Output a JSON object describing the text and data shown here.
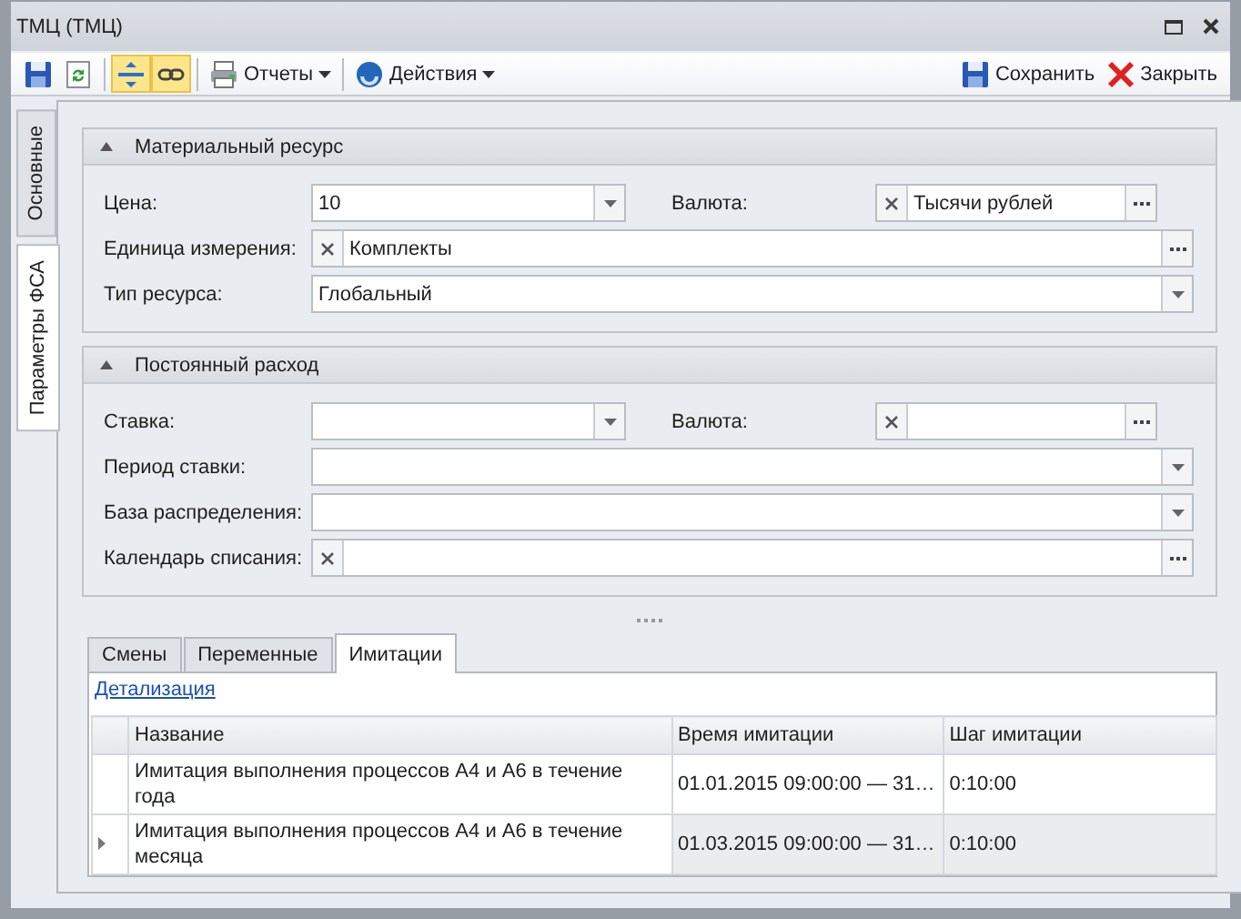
{
  "window": {
    "title": "ТМЦ (ТМЦ)"
  },
  "toolbar": {
    "toggles": [
      {
        "on": true
      },
      {
        "on": true
      }
    ],
    "menus": [
      {
        "label": "Отчеты"
      },
      {
        "label": "Действия"
      }
    ],
    "actions": [
      {
        "label": "Сохранить"
      },
      {
        "label": "Закрыть"
      }
    ]
  },
  "side_tabs": [
    {
      "label": "Основные",
      "selected": false
    },
    {
      "label": "Параметры ФСА",
      "selected": true
    }
  ],
  "groups": [
    {
      "title": "Материальный ресурс",
      "expanded": true,
      "rows": [
        [
          {
            "label": "Цена:",
            "kind": "dropdown",
            "value": "10"
          },
          {
            "label": "Валюта:",
            "kind": "lookup",
            "value": "Тысячи рублей"
          }
        ],
        [
          {
            "label": "Единица измерения:",
            "kind": "lookup",
            "value": "Комплекты"
          }
        ],
        [
          {
            "label": "Тип ресурса:",
            "kind": "dropdown",
            "value": "Глобальный"
          }
        ]
      ]
    },
    {
      "title": "Постоянный расход",
      "expanded": true,
      "rows": [
        [
          {
            "label": "Ставка:",
            "kind": "dropdown"
          },
          {
            "label": "Валюта:",
            "kind": "lookup"
          }
        ],
        [
          {
            "label": "Период ставки:",
            "kind": "dropdown"
          }
        ],
        [
          {
            "label": "База распределения:",
            "kind": "dropdown"
          }
        ],
        [
          {
            "label": "Календарь списания:",
            "kind": "lookup"
          }
        ]
      ]
    }
  ],
  "bottom_tabs": [
    {
      "label": "Смены",
      "selected": false
    },
    {
      "label": "Переменные",
      "selected": false
    },
    {
      "label": "Имитации",
      "selected": true
    }
  ],
  "detail_link": "Детализация",
  "table": {
    "columns": [
      "Название",
      "Время имитации",
      "Шаг имитации"
    ],
    "rows": [
      {
        "selected": false,
        "cells": [
          "Имитация выполнения процессов А4 и А6 в течение года",
          "01.01.2015 09:00:00 — 31…",
          "0:10:00"
        ]
      },
      {
        "selected": true,
        "cells": [
          "Имитация выполнения процессов А4 и А6 в течение месяца",
          "01.03.2015 09:00:00 — 31…",
          "0:10:00"
        ]
      }
    ]
  }
}
